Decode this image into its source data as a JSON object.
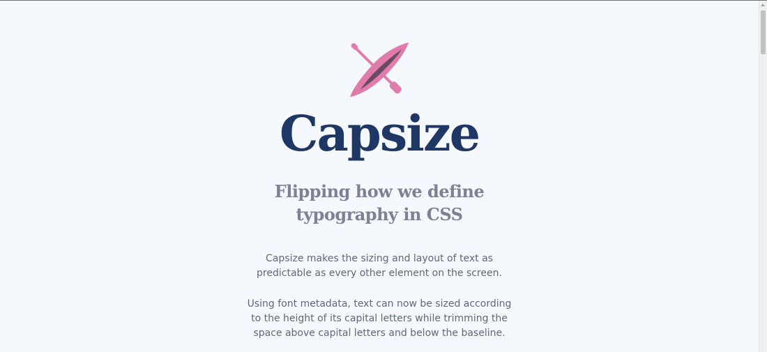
{
  "hero": {
    "logo_icon": "kayak-with-paddle-icon",
    "logo_colors": {
      "hull": "#e07bab",
      "cockpit": "#6b4a64"
    },
    "title": "Capsize",
    "title_color": "#1e3764",
    "tagline_lines": [
      "Flipping how we define",
      "typography in CSS"
    ],
    "tagline_color": "#7c8195"
  },
  "intro": {
    "paragraph1_lines": [
      "Capsize makes the sizing and layout of text as",
      "predictable as every other element on the screen."
    ],
    "paragraph2_lines": [
      "Using font metadata, text can now be sized according",
      "to the height of its capital letters while trimming the",
      "space above capital letters and below the baseline."
    ],
    "text_color": "#606779"
  },
  "page": {
    "background": "#f5f8fc"
  },
  "scrollbar": {
    "up_icon": "scroll-up-arrow-icon"
  }
}
